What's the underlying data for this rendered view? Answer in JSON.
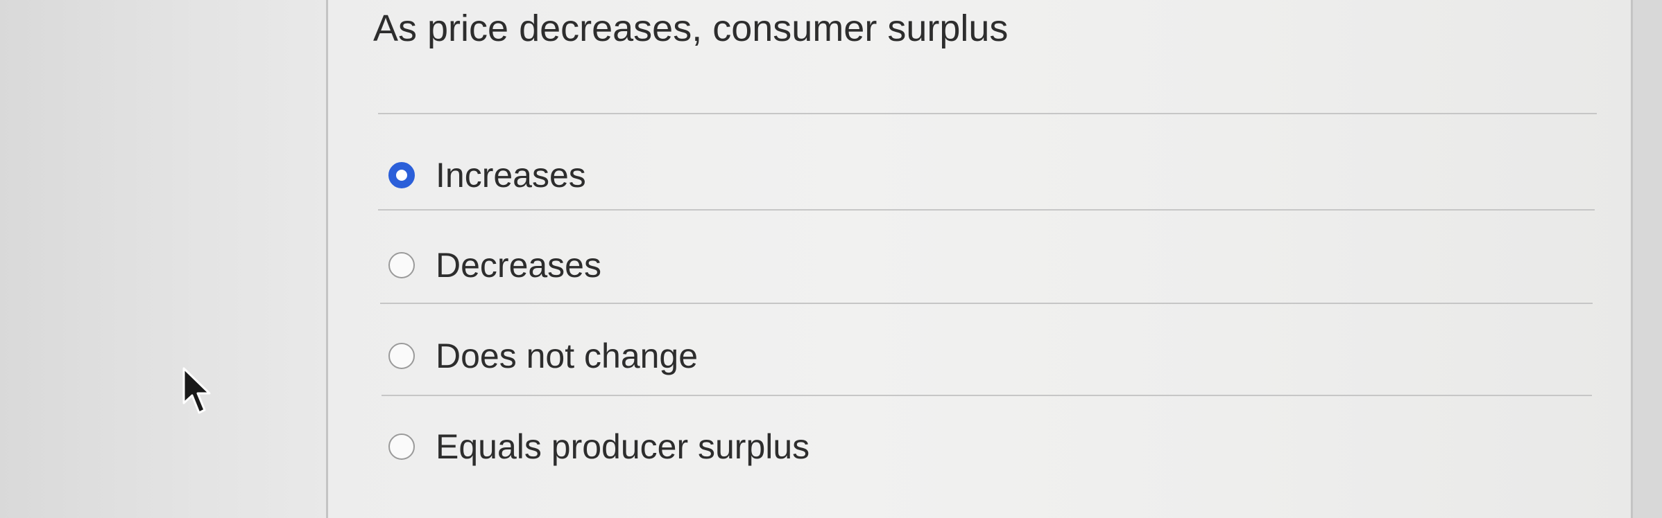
{
  "question": {
    "text": "As price decreases, consumer surplus"
  },
  "options": [
    {
      "label": "Increases",
      "selected": true
    },
    {
      "label": "Decreases",
      "selected": false
    },
    {
      "label": "Does not change",
      "selected": false
    },
    {
      "label": "Equals producer surplus",
      "selected": false
    }
  ],
  "colors": {
    "selected_radio": "#2b5fd9",
    "text": "#2d2d2d"
  },
  "icons": {
    "pointer": "mouse-pointer-icon"
  }
}
